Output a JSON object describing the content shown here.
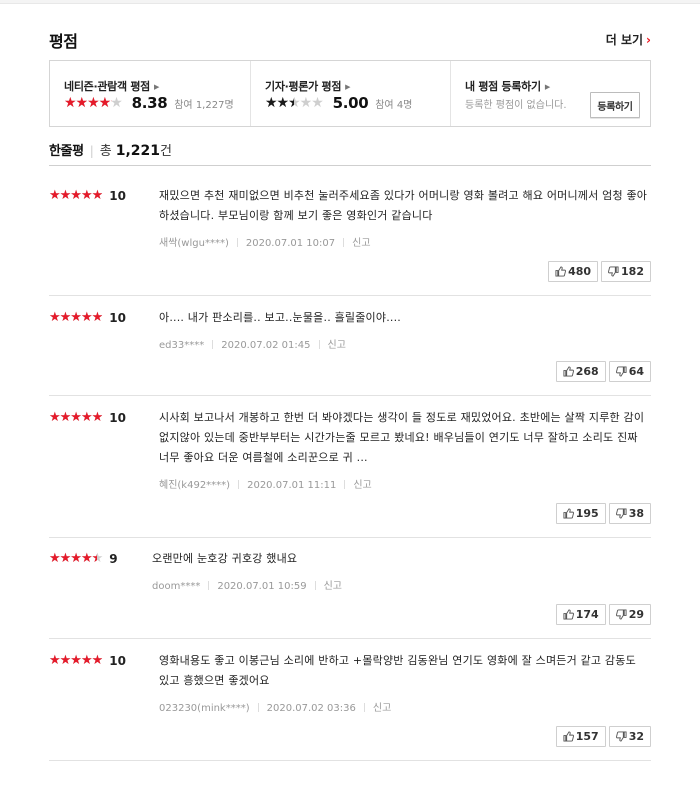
{
  "header": {
    "title": "평점",
    "more_label": "더 보기",
    "more_arrow": "›"
  },
  "summary": {
    "netizen": {
      "label": "네티즌·관람객 평점",
      "score": "8.38",
      "score_value": 8.38,
      "count": "참여 1,227명",
      "star_color": "#e51a2a"
    },
    "critic": {
      "label": "기자·평론가 평점",
      "score": "5.00",
      "score_value": 5.0,
      "count": "참여 4명",
      "star_color": "#1a1a1a"
    },
    "mine": {
      "label": "내 평점 등록하기",
      "subtext": "등록한 평점이 없습니다.",
      "button_label": "등록하기"
    }
  },
  "oneline": {
    "title": "한줄평",
    "total_label": "총",
    "total_count": "1,221",
    "unit": "건"
  },
  "reviews": [
    {
      "score": "10",
      "score_value": 10,
      "text": "재밌으면 추천 재미없으면 비추천 눌러주세요좀 있다가 어머니랑 영화 볼려고 해요 어머니께서 엄청 좋아하셨습니다. 부모님이랑 함께 보기 좋은 영화인거 같습니다",
      "user": "새싹(wlgu****)",
      "date": "2020.07.01 10:07",
      "report": "신고",
      "likes": "480",
      "dislikes": "182"
    },
    {
      "score": "10",
      "score_value": 10,
      "text": "아.... 내가 판소리를.. 보고..눈물을.. 흘릴줄이야....",
      "user": "ed33****",
      "date": "2020.07.02 01:45",
      "report": "신고",
      "likes": "268",
      "dislikes": "64"
    },
    {
      "score": "10",
      "score_value": 10,
      "text": "시사회 보고나서 개봉하고 한번 더 봐야겠다는 생각이 들 정도로 재밌었어요. 초반에는 살짝 지루한 감이 없지않아 있는데 중반부부터는 시간가는줄 모르고 봤네요! 배우님들이 연기도 너무 잘하고 소리도 진짜 너무 좋아요 더운 여름철에 소리꾼으로 귀 ...",
      "user": "혜진(k492****)",
      "date": "2020.07.01 11:11",
      "report": "신고",
      "likes": "195",
      "dislikes": "38"
    },
    {
      "score": "9",
      "score_value": 9,
      "text": "오랜만에 눈호강 귀호강 했내요",
      "user": "doom****",
      "date": "2020.07.01 10:59",
      "report": "신고",
      "likes": "174",
      "dislikes": "29"
    },
    {
      "score": "10",
      "score_value": 10,
      "text": "영화내용도 좋고 이봉근님 소리에 반하고 +몰락양반 김동완님 연기도 영화에 잘 스며든거 같고 감동도 있고 흥했으면 좋겠어요",
      "user": "023230(mink****)",
      "date": "2020.07.02 03:36",
      "report": "신고",
      "likes": "157",
      "dislikes": "32"
    }
  ],
  "colors": {
    "accent": "#f0141e",
    "star_red": "#e51a2a",
    "star_empty": "#cfcfcf"
  }
}
